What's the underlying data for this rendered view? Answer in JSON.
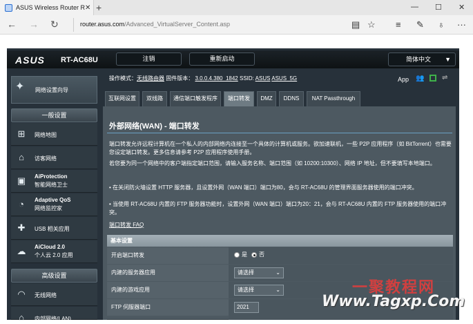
{
  "browser": {
    "tab_title": "ASUS Wireless Router R",
    "tab_close": "✕",
    "new_tab": "+",
    "minimize": "—",
    "maximize": "☐",
    "close": "✕",
    "url_domain": "router.asus.com",
    "url_path": "/Advanced_VirtualServer_Content.asp",
    "back_icon": "←",
    "forward_icon": "→",
    "refresh_icon": "↻"
  },
  "header": {
    "logo": "ASUS",
    "model": "RT-AC68U",
    "logout": "注销",
    "reboot": "重新启动",
    "language": "简体中文",
    "op_mode_label": "操作模式：",
    "op_mode": "无线路由器",
    "firmware_label": "固件版本：",
    "firmware": "3.0.0.4.380_1842",
    "ssid_label": "SSID:",
    "ssid1": "ASUS",
    "ssid2": "ASUS_5G",
    "app": "App"
  },
  "sidebar": {
    "qis": "网络设置向导",
    "general_title": "一般设置",
    "items": [
      {
        "label": "网络地图",
        "icon": "network-map-icon"
      },
      {
        "label": "访客网络",
        "icon": "guest-network-icon"
      },
      {
        "label": "AiProtection",
        "sub": "智能网络卫士",
        "icon": "aiprotection-icon"
      },
      {
        "label": "Adaptive QoS",
        "sub": "网络监控家",
        "icon": "qos-icon"
      },
      {
        "label": "USB 相关应用",
        "icon": "usb-icon"
      },
      {
        "label": "AiCloud 2.0",
        "sub": "个人云 2.0 应用",
        "icon": "cloud-icon"
      }
    ],
    "advanced_title": "高级设置",
    "advanced_items": [
      {
        "label": "无线网络",
        "icon": "wireless-icon"
      },
      {
        "label": "内部网络(LAN)",
        "icon": "lan-icon"
      }
    ]
  },
  "tabs": [
    "互联网设置",
    "双线路",
    "通信端口触发程序",
    "端口转发",
    "DMZ",
    "DDNS",
    "NAT Passthrough"
  ],
  "content": {
    "title": "外部网络(WAN) - 端口转发",
    "para1": "端口转发允许远程计算机在一个私人的内部网络内连接至一个具体的计算机或服务。欲加速联机，一些 P2P 应用程序（如 BitTorrent）也需要您设定端口转发。更多信息请参考 P2P 应用程序使用手册。",
    "para2": "若您要为同一个网络中的客户端指定端口范围，请输入服务名称、端口范围（如 10200:10300）、网络 IP 地址，但不要填写本地端口。",
    "bullet1": "• 在关闭防火墙设置 HTTP 服务器，且设置外网（WAN 端口）端口为80，会与 RT-AC68U 的管理界面服务器使用的端口冲突。",
    "bullet2": "• 当使用 RT-AC68U 内置的 FTP 服务器功能时，设置外网（WAN 端口）端口为20：21，会与 RT-AC68U 内置的 FTP 服务器使用的端口冲突。",
    "faq": "端口转发 FAQ",
    "table_title": "基本设置",
    "rows": {
      "enable_label": "开启端口转发",
      "yes": "是",
      "no": "否",
      "server_label": "内建的服务器应用",
      "server_value": "请选择",
      "game_label": "内建的游戏应用",
      "game_value": "请选择",
      "ftp_label": "FTP 伺服器端口",
      "ftp_value": "2021"
    }
  },
  "watermark": {
    "line1": "一聚教程网",
    "line2": "Www.Tagxp.Com"
  }
}
